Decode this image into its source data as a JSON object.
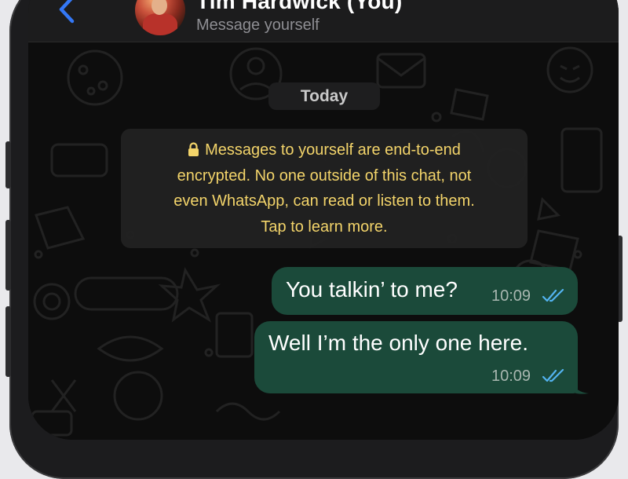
{
  "header": {
    "title": "Tim Hardwick (You)",
    "subtitle": "Message yourself"
  },
  "chat": {
    "date_label": "Today",
    "encryption_notice": {
      "lines": [
        "Messages to yourself are end-to-end",
        "encrypted. No one outside of this chat, not",
        "even WhatsApp, can read or listen to them.",
        "Tap to learn more."
      ]
    },
    "messages": [
      {
        "text": "You talkin’ to me?",
        "time": "10:09",
        "status": "read"
      },
      {
        "text": "Well I’m the only one here.",
        "time": "10:09",
        "status": "read"
      }
    ]
  },
  "colors": {
    "accent_blue": "#3478f6",
    "outgoing_bubble": "#1b4a3a",
    "notice_text": "#f3d46a",
    "read_ticks": "#53b3f0"
  },
  "icons": [
    "back-chevron-icon",
    "lock-icon",
    "double-check-icon"
  ]
}
